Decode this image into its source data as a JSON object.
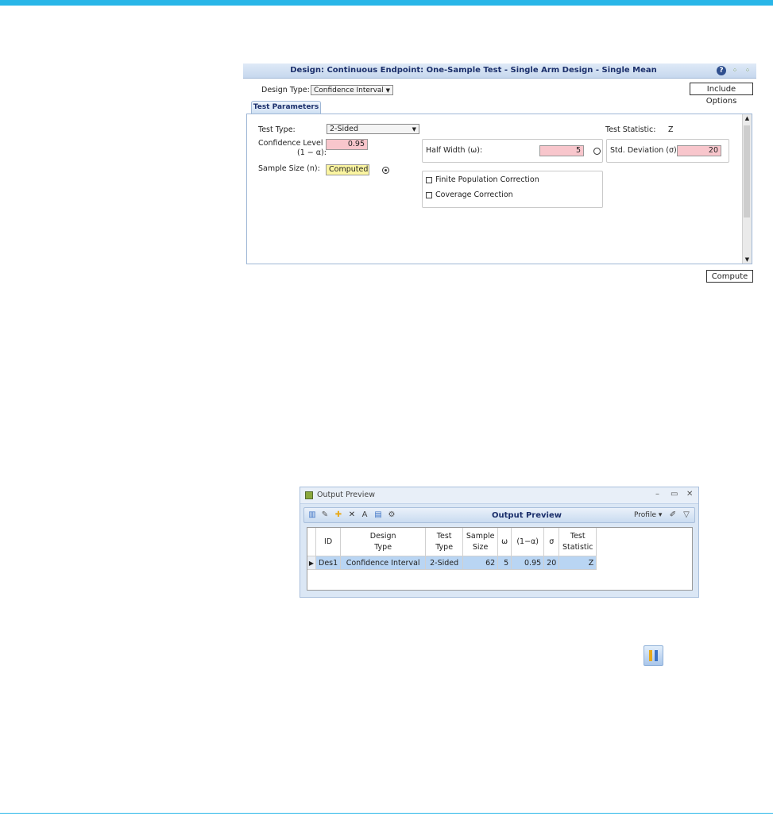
{
  "design_window": {
    "title": "Design: Continuous Endpoint: One-Sample Test - Single Arm Design - Single Mean",
    "design_type_label": "Design Type:",
    "design_type_value": "Confidence Interval",
    "include_options_label": "Include Options",
    "tab_label": "Test Parameters",
    "test_type_label": "Test Type:",
    "test_type_value": "2-Sided",
    "confidence_level_label": "Confidence Level",
    "confidence_level_sub": "(1 − α):",
    "confidence_level_value": "0.95",
    "sample_size_label": "Sample Size (n):",
    "sample_size_value": "Computed",
    "test_statistic_label": "Test Statistic:",
    "test_statistic_value": "Z",
    "half_width_label": "Half Width (ω):",
    "half_width_value": "5",
    "std_dev_label": "Std. Deviation (σ):",
    "std_dev_value": "20",
    "finite_pop_label": "Finite Population Correction",
    "coverage_label": "Coverage Correction",
    "compute_label": "Compute"
  },
  "output_preview": {
    "window_title": "Output Preview",
    "toolbar_title": "Output Preview",
    "profile_label": "Profile",
    "columns": [
      {
        "l1": "ID",
        "l2": ""
      },
      {
        "l1": "Design",
        "l2": "Type"
      },
      {
        "l1": "Test",
        "l2": "Type"
      },
      {
        "l1": "Sample",
        "l2": "Size"
      },
      {
        "l1": "ω",
        "l2": ""
      },
      {
        "l1": "(1−α)",
        "l2": ""
      },
      {
        "l1": "σ",
        "l2": ""
      },
      {
        "l1": "Test",
        "l2": "Statistic"
      }
    ],
    "row": {
      "id": "Des1",
      "design_type": "Confidence Interval",
      "test_type": "2-Sided",
      "sample_size": "62",
      "omega": "5",
      "one_minus_alpha": "0.95",
      "sigma": "20",
      "test_statistic": "Z"
    }
  },
  "colors": {
    "accent_bar": "#29b6e8",
    "input_pink": "#f8c6cc",
    "computed_yellow": "#fbf5a1",
    "selected_row": "#b9d5f3"
  }
}
